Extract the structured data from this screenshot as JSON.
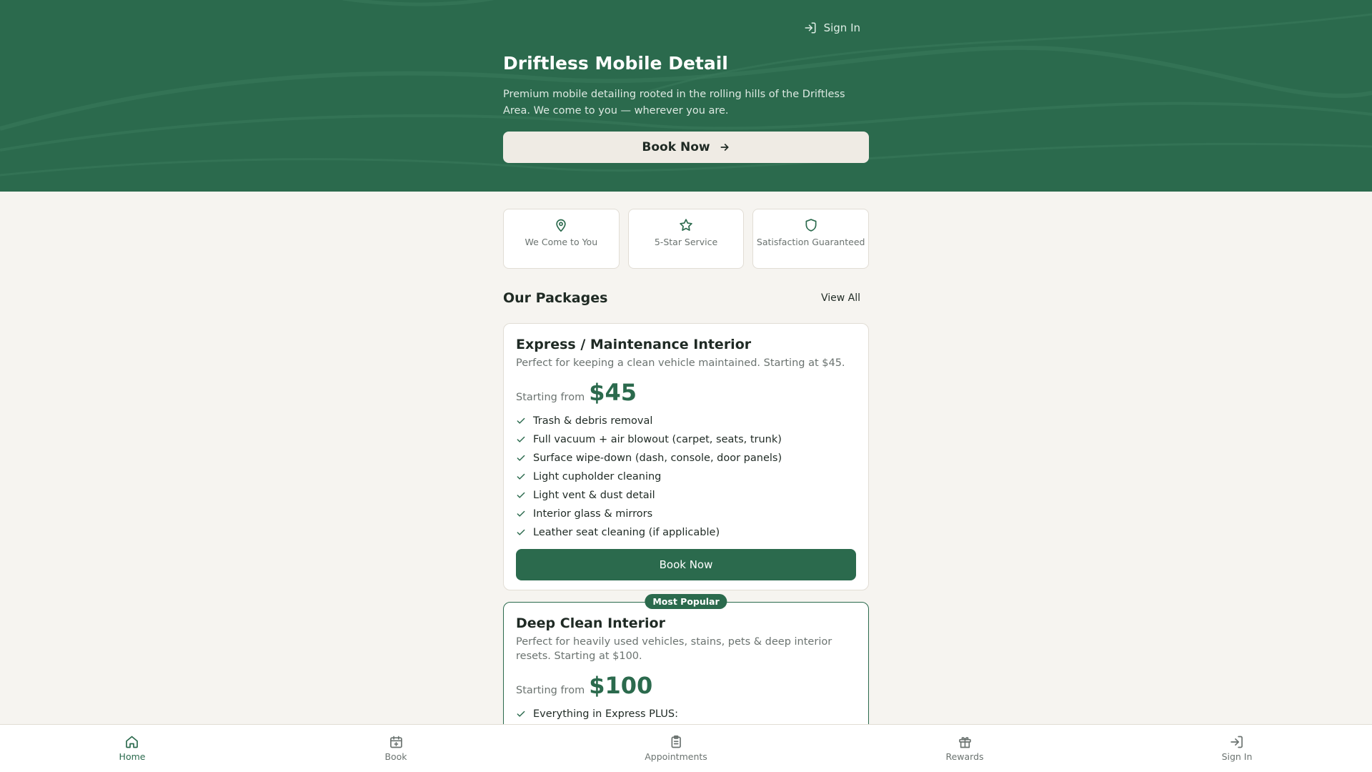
{
  "colors": {
    "brand": "#2b6a4d",
    "cream": "#efebe4",
    "background": "#f6f4f0"
  },
  "hero": {
    "sign_in": "Sign In",
    "title": "Driftless Mobile Detail",
    "subtitle": "Premium mobile detailing rooted in the rolling hills of the Driftless Area. We come to you — wherever you are.",
    "book_now": "Book Now"
  },
  "features": [
    {
      "icon": "map-pin-icon",
      "label": "We Come to You"
    },
    {
      "icon": "star-icon",
      "label": "5-Star Service"
    },
    {
      "icon": "shield-icon",
      "label": "Satisfaction Guaranteed"
    }
  ],
  "packages": {
    "heading": "Our Packages",
    "view_all": "View All",
    "items": [
      {
        "name": "Express / Maintenance Interior",
        "description": "Perfect for keeping a clean vehicle maintained. Starting at $45.",
        "starting_from": "Starting from",
        "price": "$45",
        "features": [
          "Trash & debris removal",
          "Full vacuum + air blowout (carpet, seats, trunk)",
          "Surface wipe-down (dash, console, door panels)",
          "Light cupholder cleaning",
          "Light vent & dust detail",
          "Interior glass & mirrors",
          "Leather seat cleaning (if applicable)"
        ],
        "book_now": "Book Now"
      },
      {
        "badge": "Most Popular",
        "name": "Deep Clean Interior",
        "description": "Perfect for heavily used vehicles, stains, pets & deep interior resets. Starting at $100.",
        "starting_from": "Starting from",
        "price": "$100",
        "features": [
          "Everything in Express PLUS:"
        ]
      }
    ]
  },
  "bottom_nav": [
    {
      "label": "Home",
      "icon": "home-icon",
      "active": true
    },
    {
      "label": "Book",
      "icon": "calendar-plus-icon"
    },
    {
      "label": "Appointments",
      "icon": "clipboard-icon"
    },
    {
      "label": "Rewards",
      "icon": "gift-icon"
    },
    {
      "label": "Sign In",
      "icon": "sign-in-icon"
    }
  ]
}
